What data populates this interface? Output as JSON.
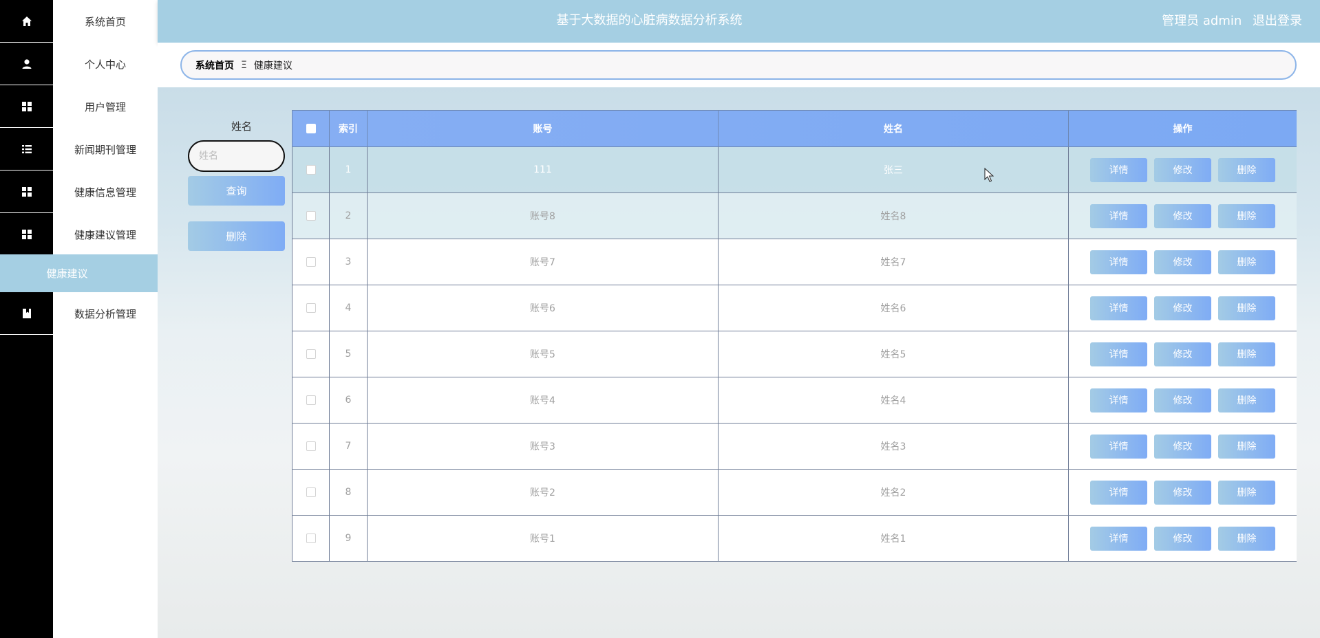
{
  "header": {
    "title": "基于大数据的心脏病数据分析系统",
    "user": "管理员 admin",
    "logout": "退出登录"
  },
  "sidebar": {
    "items": [
      {
        "label": "系统首页",
        "icon": "home-icon"
      },
      {
        "label": "个人中心",
        "icon": "user-icon"
      },
      {
        "label": "用户管理",
        "icon": "grid-icon"
      },
      {
        "label": "新闻期刊管理",
        "icon": "list-icon"
      },
      {
        "label": "健康信息管理",
        "icon": "grid-icon"
      },
      {
        "label": "健康建议管理",
        "icon": "grid-icon"
      },
      {
        "label": "数据分析管理",
        "icon": "book-icon"
      }
    ],
    "active_submenu": "健康建议"
  },
  "breadcrumb": {
    "home": "系统首页",
    "separator": "Ξ",
    "current": "健康建议"
  },
  "search": {
    "label": "姓名",
    "placeholder": "姓名",
    "value": "",
    "query_label": "查询",
    "delete_label": "删除"
  },
  "table": {
    "columns": [
      "索引",
      "账号",
      "姓名",
      "操作"
    ],
    "actions": {
      "detail": "详情",
      "edit": "修改",
      "delete": "删除"
    },
    "rows": [
      {
        "index": "1",
        "account": "111",
        "name": "张三"
      },
      {
        "index": "2",
        "account": "账号8",
        "name": "姓名8"
      },
      {
        "index": "3",
        "account": "账号7",
        "name": "姓名7"
      },
      {
        "index": "4",
        "account": "账号6",
        "name": "姓名6"
      },
      {
        "index": "5",
        "account": "账号5",
        "name": "姓名5"
      },
      {
        "index": "6",
        "account": "账号4",
        "name": "姓名4"
      },
      {
        "index": "7",
        "account": "账号3",
        "name": "姓名3"
      },
      {
        "index": "8",
        "account": "账号2",
        "name": "姓名2"
      },
      {
        "index": "9",
        "account": "账号1",
        "name": "姓名1"
      }
    ]
  },
  "colors": {
    "accent": "#a5cfe3",
    "button_start": "#a3cbe5",
    "button_end": "#7facf5",
    "table_header": "#86aef3"
  }
}
